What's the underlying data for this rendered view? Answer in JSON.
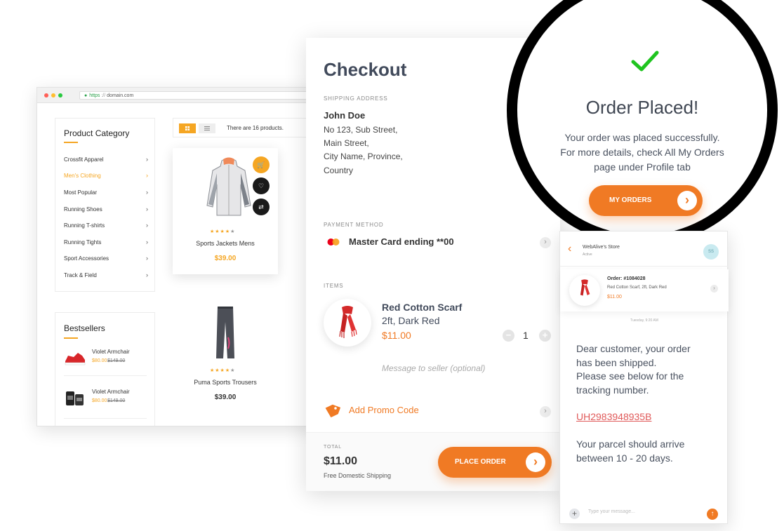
{
  "browser": {
    "url_scheme": "https",
    "url_domain": "domain.com",
    "categories_title": "Product Category",
    "categories": [
      {
        "label": "Crossfit Apparel",
        "active": false
      },
      {
        "label": "Men's Clothing",
        "active": true
      },
      {
        "label": "Most Popular",
        "active": false
      },
      {
        "label": "Running Shoes",
        "active": false
      },
      {
        "label": "Running T-shirts",
        "active": false
      },
      {
        "label": "Running Tights",
        "active": false
      },
      {
        "label": "Sport Accessories",
        "active": false
      },
      {
        "label": "Track & Field",
        "active": false
      }
    ],
    "bestsellers_title": "Bestsellers",
    "bestsellers": [
      {
        "name": "Violet Armchair",
        "sale_price": "$80.00",
        "old_price": "$149.00"
      },
      {
        "name": "Violet Armchair",
        "sale_price": "$80.00",
        "old_price": "$149.00"
      }
    ],
    "product_count_text": "There are 16 products.",
    "products": [
      {
        "name": "Sports Jackets Mens",
        "price": "$39.00",
        "rating": 4
      },
      {
        "name": "Puma Sports Trousers",
        "price": "$39.00",
        "rating": 4
      }
    ]
  },
  "checkout": {
    "title": "Checkout",
    "shipping_label": "SHIPPING ADDRESS",
    "name": "John Doe",
    "address": [
      "No 123, Sub Street,",
      "Main Street,",
      "City Name, Province,",
      "Country"
    ],
    "payment_label": "PAYMENT METHOD",
    "payment_method": "Master Card ending **00",
    "items_label": "ITEMS",
    "item_name": "Red Cotton Scarf",
    "item_variant": "2ft, Dark Red",
    "item_price": "$11.00",
    "quantity": "1",
    "message_placeholder": "Message to seller (optional)",
    "promo_label": "Add Promo Code",
    "total_label": "TOTAL",
    "total_amount": "$11.00",
    "shipping_note": "Free Domestic Shipping",
    "place_order_label": "PLACE ORDER"
  },
  "order_placed": {
    "title": "Order Placed!",
    "lines": [
      "Your order was placed successfully.",
      "For more details, check All My Orders",
      "page under Profile tab"
    ],
    "button_label": "MY ORDERS"
  },
  "chat": {
    "store_name": "WebAlive's Store",
    "store_status": "Active",
    "avatar_initials": "SS",
    "order_number": "Order: #1084028",
    "order_item": "Red Cotton Scarf, 2ft, Dark Red",
    "order_price": "$11.00",
    "timestamp": "Tuesday, 9:20 AM",
    "message_lines": [
      "Dear customer, your order",
      "has been shipped.",
      "Please see below for the",
      "tracking number."
    ],
    "tracking_number": "UH2983948935B",
    "message2_lines": [
      "Your parcel should arrive",
      "between 10 - 20 days."
    ],
    "input_placeholder": "Type your message..."
  },
  "colors": {
    "accent_orange": "#f07a24",
    "accent_yellow": "#f5a623",
    "success_green": "#1fc41f",
    "link_red": "#e05a5a"
  }
}
